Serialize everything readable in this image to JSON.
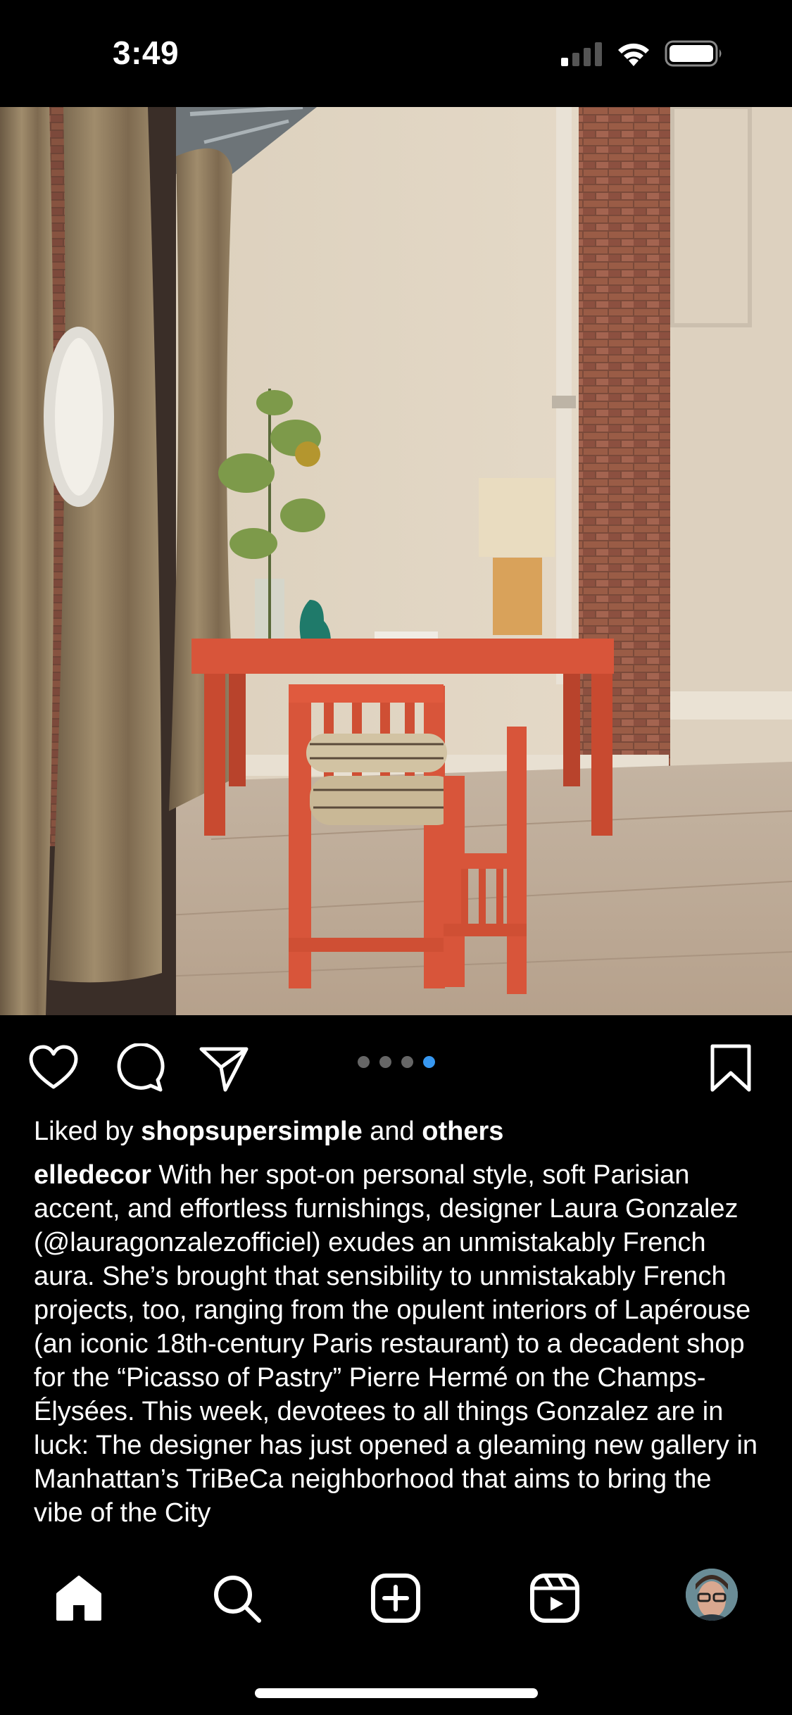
{
  "status_bar": {
    "time": "3:49"
  },
  "post": {
    "image_alt": "post-photo",
    "carousel": {
      "count": 4,
      "active_index": 3
    },
    "likes": {
      "prefix": "Liked by ",
      "user": "shopsupersimple",
      "middle": " and ",
      "others": "others"
    },
    "caption": {
      "author": "elledecor",
      "text": " With her spot-on personal style, soft Parisian accent, and effortless furnishings, designer Laura Gonzalez (@lauragonzalezofficiel) exudes an unmistakably French aura. She’s brought that sensibility to unmistakably French projects, too, ranging from the opulent interiors of Lapérouse (an iconic 18th-century Paris restaurant) to a decadent shop for the “Picasso of Pastry” Pierre Hermé on the Champs-Élysées. This week, devotees to all things Gonzalez are in luck: The designer has just opened a gleaming new gallery in Manhattan’s TriBeCa neighborhood that aims to bring the vibe of the City"
    }
  },
  "actions": [
    "heart-icon",
    "comment-icon",
    "share-icon",
    "bookmark-icon"
  ],
  "bottom_nav": [
    "home-icon",
    "search-icon",
    "create-icon",
    "reels-icon",
    "profile-avatar"
  ],
  "colors": {
    "accent_dot": "#3797f0",
    "background": "#000000",
    "desk": "#d8553a"
  }
}
